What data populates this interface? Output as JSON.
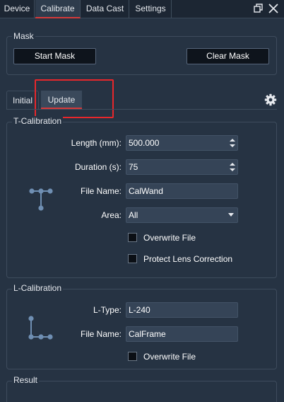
{
  "top_tabs": [
    {
      "label": "Device",
      "active": false
    },
    {
      "label": "Calibrate",
      "active": true
    },
    {
      "label": "Data Cast",
      "active": false
    },
    {
      "label": "Settings",
      "active": false
    }
  ],
  "window_controls": {
    "restore_icon": "restore-window-icon",
    "close_icon": "close-icon"
  },
  "mask": {
    "title": "Mask",
    "start_button": "Start Mask",
    "clear_button": "Clear Mask"
  },
  "inner_tabs": [
    {
      "label": "Initial",
      "active": false
    },
    {
      "label": "Update",
      "active": true
    }
  ],
  "settings_icon": "gear-icon",
  "t_calibration": {
    "title": "T-Calibration",
    "icon": "t-wand-icon",
    "length_label": "Length (mm):",
    "length_value": "500.000",
    "duration_label": "Duration (s):",
    "duration_value": "75",
    "file_name_label": "File Name:",
    "file_name_value": "CalWand",
    "area_label": "Area:",
    "area_value": "All",
    "overwrite_label": "Overwrite File",
    "protect_label": "Protect Lens Correction"
  },
  "l_calibration": {
    "title": "L-Calibration",
    "icon": "l-frame-icon",
    "ltype_label": "L-Type:",
    "ltype_value": "L-240",
    "file_name_label": "File Name:",
    "file_name_value": "CalFrame",
    "overwrite_label": "Overwrite File"
  },
  "result": {
    "title": "Result"
  },
  "colors": {
    "background": "#263343",
    "accent_underline": "#d63a3a",
    "highlight_box": "#e8272b",
    "field_bg": "#354457"
  }
}
